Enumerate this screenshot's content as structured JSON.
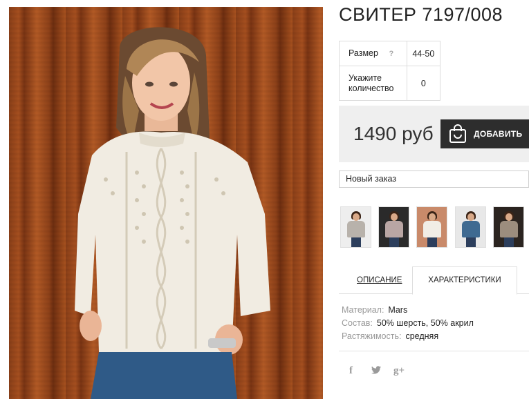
{
  "product": {
    "title": "СВИТЕР 7197/008"
  },
  "options": {
    "size_label": "Размер",
    "size_help": "?",
    "size_value": "44-50",
    "qty_label_line1": "Укажите",
    "qty_label_line2": "количество",
    "qty_value": "0"
  },
  "purchase": {
    "price": "1490 руб",
    "add_label": "ДОБАВИТЬ"
  },
  "order": {
    "selected": "Новый заказ"
  },
  "thumbnails": [
    {
      "sweater_color": "#b8b2ab",
      "bg": "#eeeeee"
    },
    {
      "sweater_color": "#b9a6a4",
      "bg": "#2a2a2a"
    },
    {
      "sweater_color": "#f1ede6",
      "bg": "#c98a6a"
    },
    {
      "sweater_color": "#3f6a91",
      "bg": "#e8e8e8"
    },
    {
      "sweater_color": "#9c8d7e",
      "bg": "#2b2420"
    }
  ],
  "tabs": {
    "description": "ОПИСАНИЕ",
    "characteristics": "ХАРАКТЕРИСТИКИ"
  },
  "characteristics": [
    {
      "key": "Материал:",
      "value": "Mars"
    },
    {
      "key": "Состав:",
      "value": "50% шерсть, 50% акрил"
    },
    {
      "key": "Растяжимость:",
      "value": "средняя"
    }
  ],
  "social": {
    "facebook": "f",
    "twitter": "🐦",
    "googleplus": "g+"
  },
  "colors": {
    "button_bg": "#2d2d2d",
    "price_box_bg": "#efefef",
    "muted_text": "#999999"
  }
}
